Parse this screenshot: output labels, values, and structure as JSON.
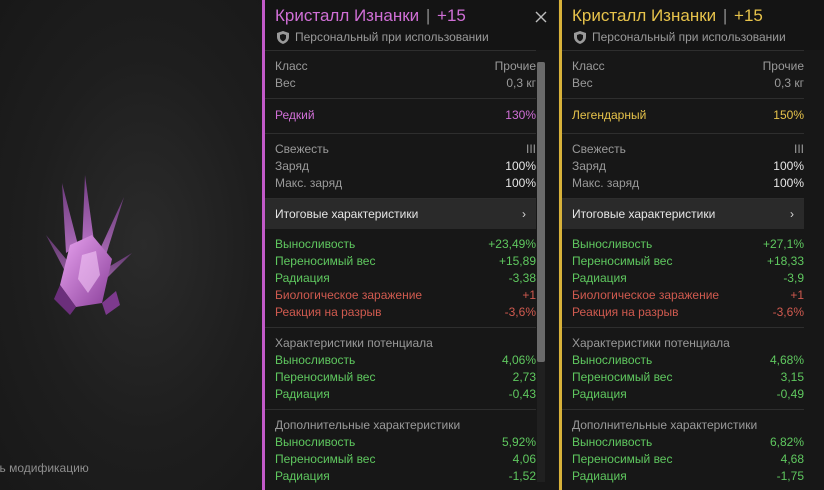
{
  "scene": {
    "hint_text": "ть модификацию"
  },
  "left_item": {
    "title_name": "Кристалл Изнанки",
    "title_sep": "|",
    "title_level": "+15",
    "subtitle": "Персональный при использовании",
    "basic": [
      {
        "label": "Класс",
        "value": "Прочие"
      },
      {
        "label": "Вес",
        "value": "0,3 кг"
      }
    ],
    "rarity": {
      "label": "Редкий",
      "value": "130%"
    },
    "condition": [
      {
        "label": "Свежесть",
        "value": "III"
      },
      {
        "label": "Заряд",
        "value": "100%"
      },
      {
        "label": "Макс. заряд",
        "value": "100%"
      }
    ],
    "summary_label": "Итоговые характеристики",
    "summary_chevron": "›",
    "final_stats": [
      {
        "label": "Выносливость",
        "value": "+23,49%",
        "tone": "green"
      },
      {
        "label": "Переносимый вес",
        "value": "+15,89",
        "tone": "green"
      },
      {
        "label": "Радиация",
        "value": "-3,38",
        "tone": "green"
      },
      {
        "label": "Биологическое заражение",
        "value": "+1",
        "tone": "red"
      },
      {
        "label": "Реакция на разрыв",
        "value": "-3,6%",
        "tone": "red"
      }
    ],
    "potential_title": "Характеристики потенциала",
    "potential_stats": [
      {
        "label": "Выносливость",
        "value": "4,06%"
      },
      {
        "label": "Переносимый вес",
        "value": "2,73"
      },
      {
        "label": "Радиация",
        "value": "-0,43"
      }
    ],
    "extra_title": "Дополнительные характеристики",
    "extra_stats": [
      {
        "label": "Выносливость",
        "value": "5,92%"
      },
      {
        "label": "Переносимый вес",
        "value": "4,06"
      },
      {
        "label": "Радиация",
        "value": "-1,52"
      }
    ]
  },
  "right_item": {
    "title_name": "Кристалл Изнанки",
    "title_sep": "|",
    "title_level": "+15",
    "subtitle": "Персональный при использовании",
    "basic": [
      {
        "label": "Класс",
        "value": "Прочие"
      },
      {
        "label": "Вес",
        "value": "0,3 кг"
      }
    ],
    "rarity": {
      "label": "Легендарный",
      "value": "150%"
    },
    "condition": [
      {
        "label": "Свежесть",
        "value": "III"
      },
      {
        "label": "Заряд",
        "value": "100%"
      },
      {
        "label": "Макс. заряд",
        "value": "100%"
      }
    ],
    "summary_label": "Итоговые характеристики",
    "summary_chevron": "›",
    "final_stats": [
      {
        "label": "Выносливость",
        "value": "+27,1%",
        "tone": "green"
      },
      {
        "label": "Переносимый вес",
        "value": "+18,33",
        "tone": "green"
      },
      {
        "label": "Радиация",
        "value": "-3,9",
        "tone": "green"
      },
      {
        "label": "Биологическое заражение",
        "value": "+1",
        "tone": "red"
      },
      {
        "label": "Реакция на разрыв",
        "value": "-3,6%",
        "tone": "red"
      }
    ],
    "potential_title": "Характеристики потенциала",
    "potential_stats": [
      {
        "label": "Выносливость",
        "value": "4,68%"
      },
      {
        "label": "Переносимый вес",
        "value": "3,15"
      },
      {
        "label": "Радиация",
        "value": "-0,49"
      }
    ],
    "extra_title": "Дополнительные характеристики",
    "extra_stats": [
      {
        "label": "Выносливость",
        "value": "6,82%"
      },
      {
        "label": "Переносимый вес",
        "value": "4,68"
      },
      {
        "label": "Радиация",
        "value": "-1,75"
      }
    ]
  },
  "colors": {
    "rare": "#d06fd6",
    "legendary": "#e7c34b",
    "positive": "#5fc85f",
    "negative": "#d05a4f"
  },
  "icons": {
    "close": "close-icon",
    "shield": "shield-icon",
    "crystal": "crystal-icon"
  }
}
